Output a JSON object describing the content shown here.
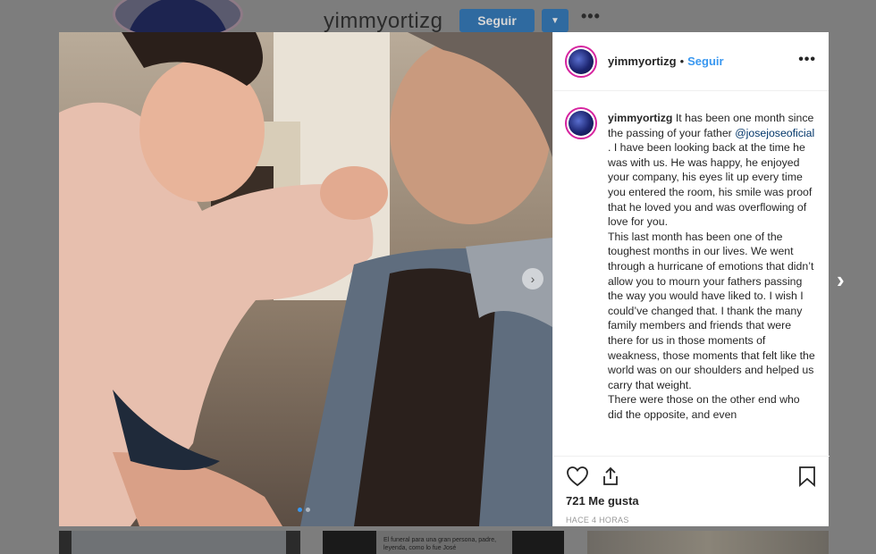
{
  "background_profile": {
    "username": "yimmyortizg",
    "follow_label": "Seguir",
    "dropdown_icon": "▼",
    "more_icon": "•••"
  },
  "grid_preview": {
    "caption": "El funeral para una gran persona, padre, leyenda, como lo fue José"
  },
  "post": {
    "username": "yimmyortizg",
    "separator": "•",
    "follow_label": "Seguir",
    "more_icon": "•••",
    "caption": {
      "username": "yimmyortizg",
      "text_1": " It has been one month since the passing of your father ",
      "mention": "@josejoseoficial",
      "text_2": " . I have been looking back at the time he was with us. He was happy, he enjoyed your company, his eyes lit up every time you entered the room, his smile was proof that he loved you and was overflowing of love for you.",
      "paragraph_2": "This last month has been one of the toughest months in our lives. We went through a hurricane of emotions that didn’t allow you to mourn your fathers passing the way you would have liked to. I wish I could’ve changed that. I thank the many family members and friends that were there for us in those moments of weakness, those moments that felt like the world was on our shoulders and helped us carry that weight.",
      "paragraph_3": "There were those on the other end who did the opposite, and even"
    },
    "likes": "721 Me gusta",
    "timestamp": "HACE 4 HORAS",
    "carousel": {
      "slides": 2,
      "active": 1
    },
    "colors": {
      "accent": "#3897f0",
      "mention": "#003569",
      "text": "#262626"
    }
  }
}
